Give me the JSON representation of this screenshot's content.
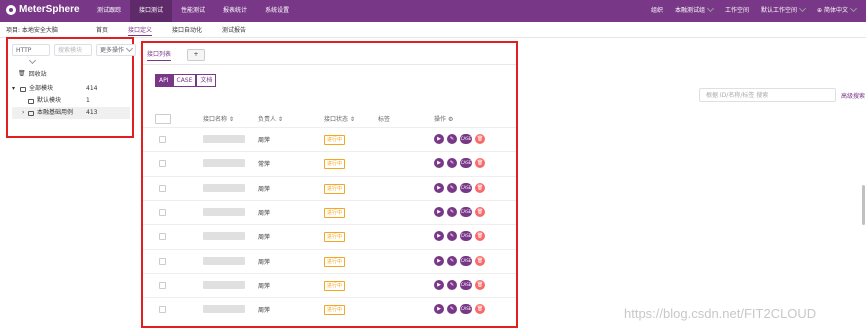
{
  "app": {
    "logo": "MeterSphere"
  },
  "nav": [
    "测试跟踪",
    "接口测试",
    "性能测试",
    "报表统计",
    "系统设置"
  ],
  "nav_active": 1,
  "top_right": {
    "org": "组织",
    "org_value": "本融测试组",
    "workspace": "工作空间",
    "workspace_value": "默认工作空间",
    "lang": "简体中文"
  },
  "project": {
    "label": "项目: 本地安全大脑"
  },
  "subtabs": [
    "首页",
    "接口定义",
    "接口自动化",
    "测试报告"
  ],
  "subtab_active": 1,
  "sidebar": {
    "protocol": "HTTP",
    "search_placeholder": "搜索模块",
    "more_ops": "更多操作",
    "trash": "回收站",
    "tree": [
      {
        "label": "全部模块",
        "count": "414"
      },
      {
        "label": "默认模块",
        "count": "1"
      },
      {
        "label": "本融基础用例",
        "count": "413"
      }
    ]
  },
  "main": {
    "tab_label": "接口列表",
    "add_tab": "+",
    "modes": [
      "API",
      "CASE",
      "文档"
    ],
    "headers": {
      "name": "接口名称",
      "owner": "负责人",
      "status": "接口状态",
      "tags": "标签",
      "ops": "操作"
    },
    "rows": [
      {
        "owner": "周萍",
        "status": "进行中"
      },
      {
        "owner": "常萍",
        "status": "进行中"
      },
      {
        "owner": "周萍",
        "status": "进行中"
      },
      {
        "owner": "周萍",
        "status": "进行中"
      },
      {
        "owner": "周萍",
        "status": "进行中"
      },
      {
        "owner": "周萍",
        "status": "进行中"
      },
      {
        "owner": "周萍",
        "status": "进行中"
      },
      {
        "owner": "周萍",
        "status": "进行中"
      }
    ],
    "op_case_label": "CASE"
  },
  "search": {
    "placeholder": "根据 ID/名称/标签 搜索",
    "advanced": "高级搜索"
  },
  "watermark": "https://blog.csdn.net/FIT2CLOUD",
  "colors": {
    "brand": "#783887",
    "highlight_box": "#e02020",
    "status_in_progress": "#f5a623",
    "delete": "#f56c6c"
  }
}
